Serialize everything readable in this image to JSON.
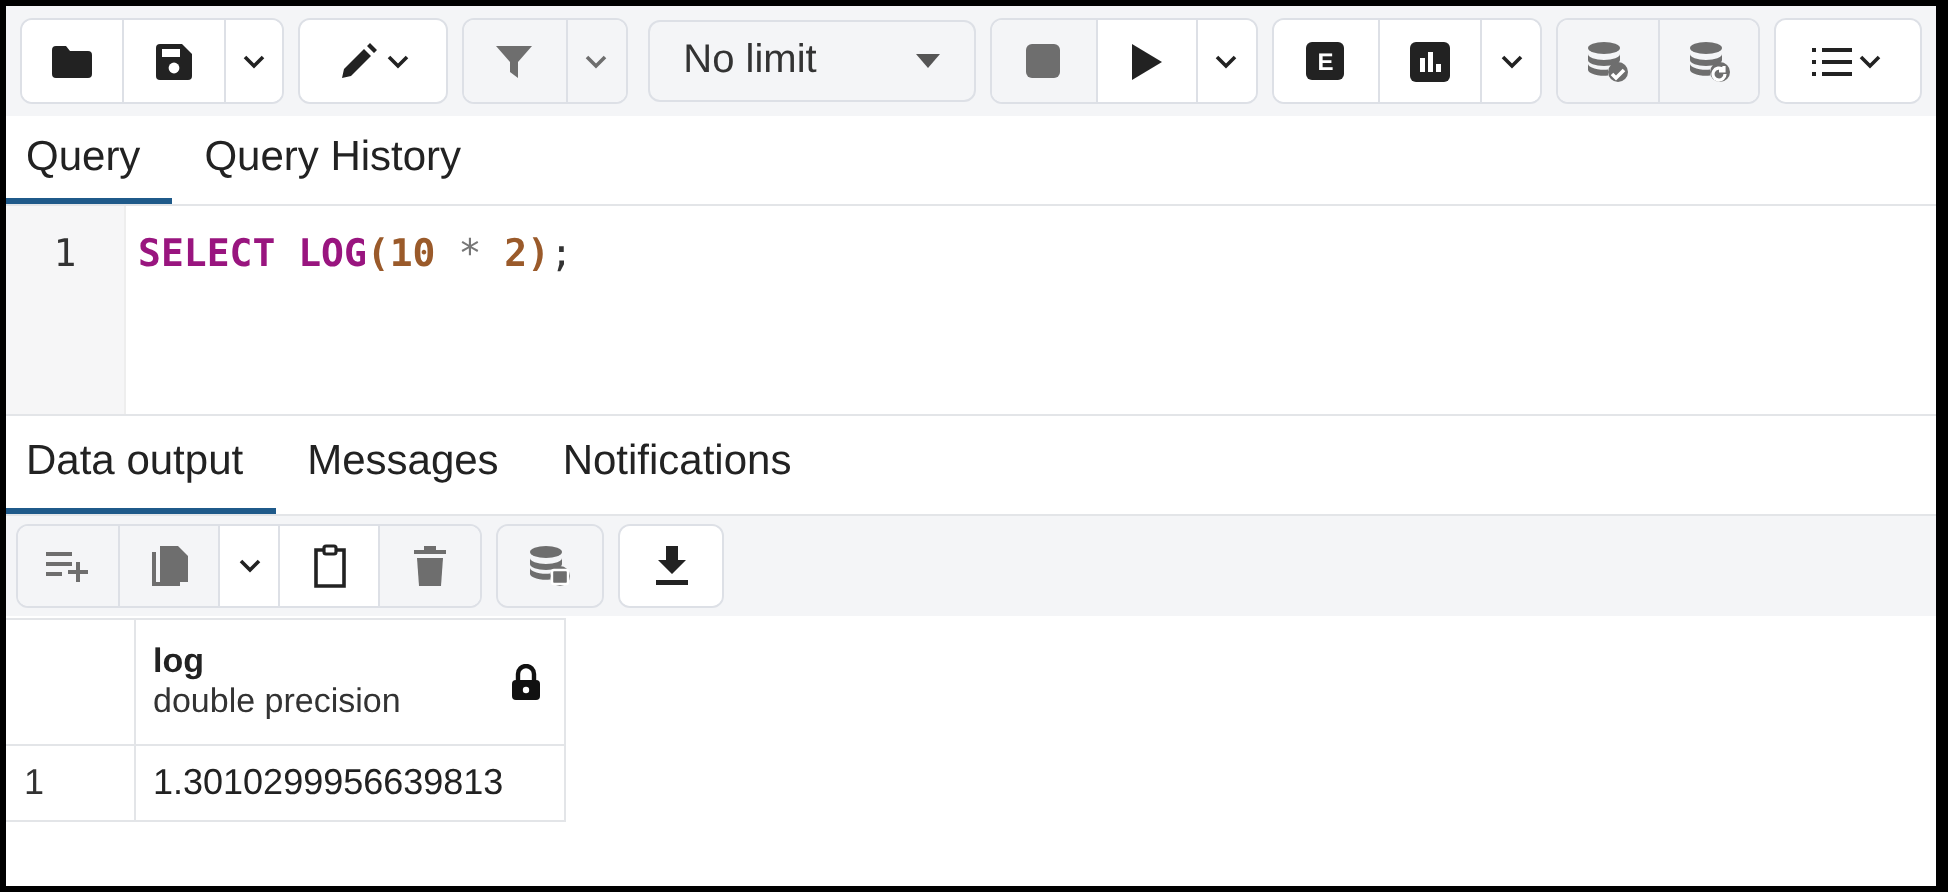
{
  "toolbar": {
    "groups": [
      {
        "buttons": [
          {
            "kind": "open",
            "disabled": false
          },
          {
            "kind": "save",
            "disabled": false
          },
          {
            "kind": "caret",
            "disabled": false
          }
        ]
      },
      {
        "buttons": [
          {
            "kind": "edit",
            "disabled": false
          }
        ]
      },
      {
        "buttons": [
          {
            "kind": "filter",
            "disabled": true
          },
          {
            "kind": "caret",
            "disabled": true
          }
        ]
      },
      {
        "select": {
          "value": "No limit"
        }
      },
      {
        "buttons": [
          {
            "kind": "stop",
            "disabled": true
          },
          {
            "kind": "execute",
            "disabled": false
          },
          {
            "kind": "caret",
            "disabled": false
          }
        ]
      },
      {
        "buttons": [
          {
            "kind": "explain",
            "label": "E",
            "disabled": false
          },
          {
            "kind": "analyze",
            "disabled": false
          },
          {
            "kind": "caret",
            "disabled": false
          }
        ]
      },
      {
        "buttons": [
          {
            "kind": "commit",
            "disabled": true
          },
          {
            "kind": "rollback",
            "disabled": true
          }
        ]
      },
      {
        "buttons": [
          {
            "kind": "macros",
            "disabled": false
          }
        ]
      }
    ]
  },
  "editor_tabs": [
    {
      "label": "Query",
      "selected": true
    },
    {
      "label": "Query History",
      "selected": false
    }
  ],
  "editor": {
    "lines": [
      {
        "number": "1",
        "tokens": [
          {
            "kind": "keyword",
            "text": "SELECT "
          },
          {
            "kind": "keyword",
            "text": "LOG"
          },
          {
            "kind": "paren",
            "text": "("
          },
          {
            "kind": "number",
            "text": "10 "
          },
          {
            "kind": "operator",
            "text": "* "
          },
          {
            "kind": "number",
            "text": "2"
          },
          {
            "kind": "paren",
            "text": ")"
          },
          {
            "kind": "punct",
            "text": ";"
          }
        ]
      }
    ]
  },
  "output_tabs": [
    {
      "label": "Data output",
      "selected": true
    },
    {
      "label": "Messages",
      "selected": false
    },
    {
      "label": "Notifications",
      "selected": false
    }
  ],
  "output_toolbar": {
    "groups": [
      {
        "buttons": [
          {
            "kind": "add-row",
            "disabled": true
          },
          {
            "kind": "copy",
            "disabled": true
          },
          {
            "kind": "caret",
            "disabled": false
          },
          {
            "kind": "paste",
            "disabled": false
          },
          {
            "kind": "delete",
            "disabled": true
          }
        ]
      },
      {
        "buttons": [
          {
            "kind": "save-data",
            "disabled": true
          }
        ]
      },
      {
        "buttons": [
          {
            "kind": "download",
            "disabled": false
          }
        ]
      }
    ]
  },
  "table": {
    "columns": [
      {
        "name": "log",
        "type": "double precision",
        "locked": true
      }
    ],
    "rows": [
      {
        "number": "1",
        "cells": [
          "1.3010299956639813"
        ]
      }
    ]
  }
}
